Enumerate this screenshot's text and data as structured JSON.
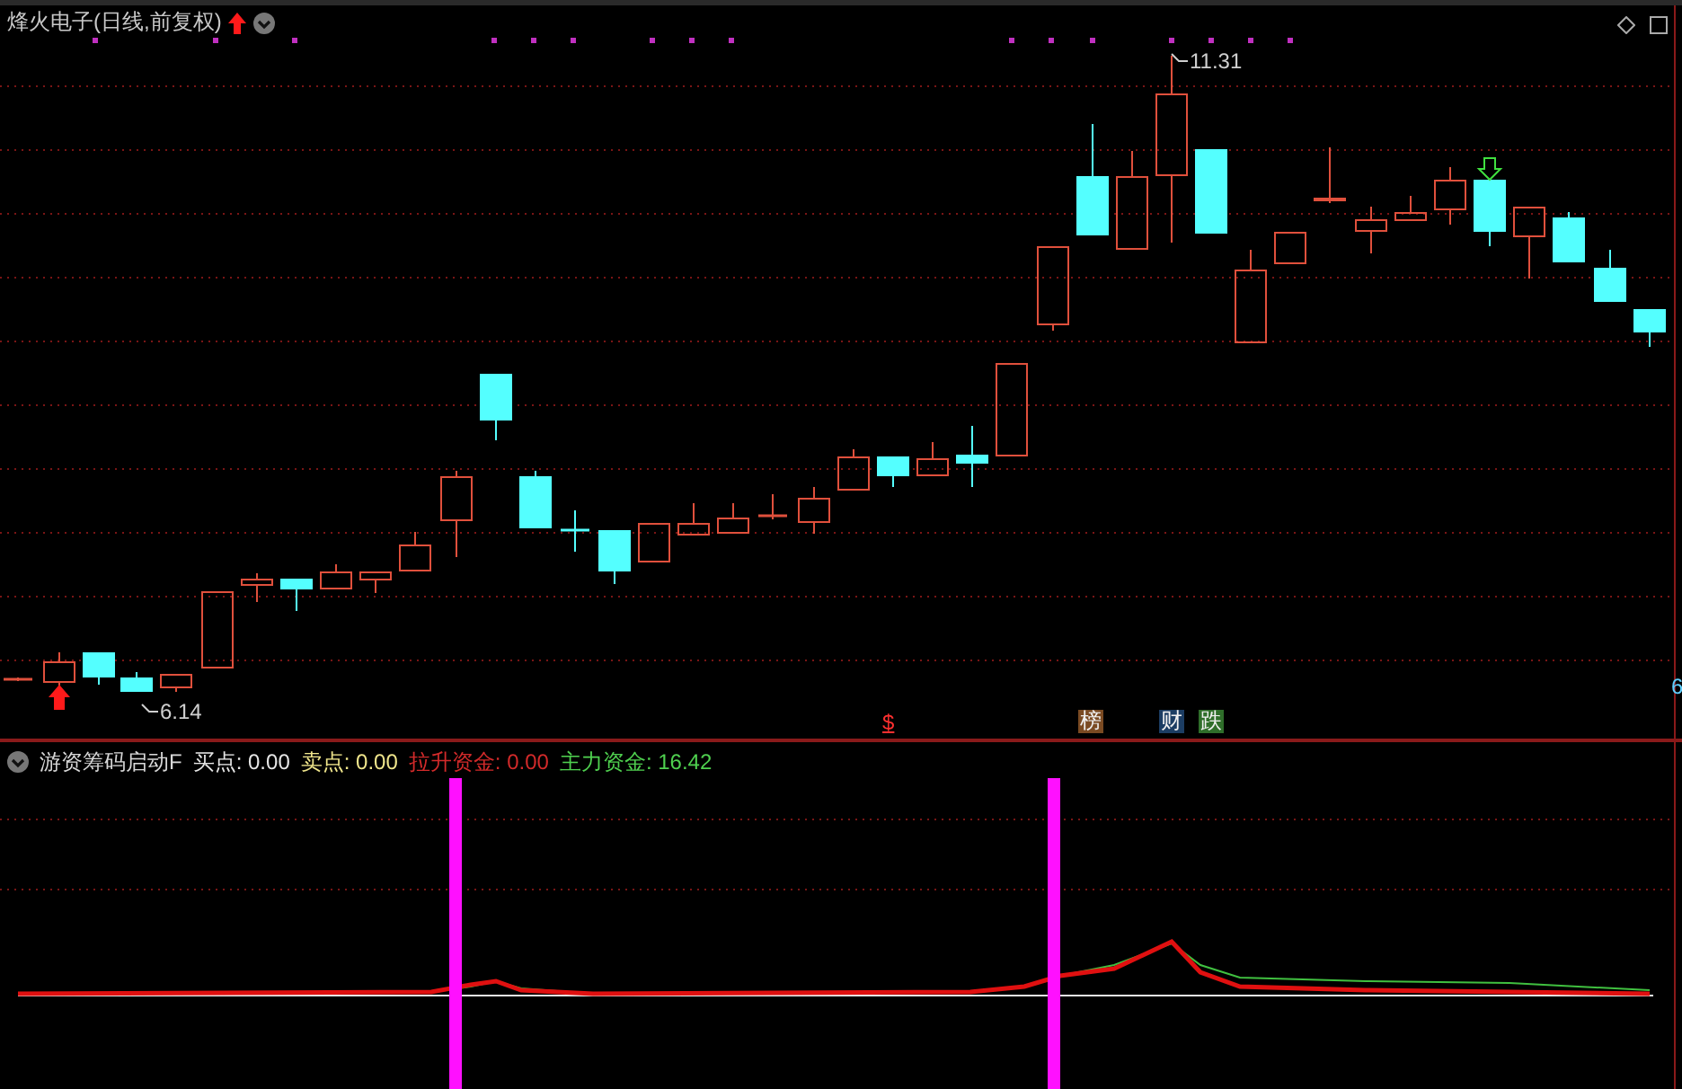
{
  "header": {
    "title": "烽火电子(日线,前复权)"
  },
  "price_labels": [
    {
      "text": "11.31"
    },
    {
      "text": "6.14"
    }
  ],
  "signal_badges": [
    {
      "text": "$",
      "kind": "mark",
      "color": "#ff3030"
    },
    {
      "text": "榜",
      "kind": "tag",
      "color": "#7a4a22"
    },
    {
      "text": "财",
      "kind": "tag",
      "color": "#1c3d63"
    },
    {
      "text": "跌",
      "kind": "tag",
      "color": "#2f6e2a"
    }
  ],
  "axis_label": "6",
  "indicator": {
    "name": "游资筹码启动F",
    "readings": [
      {
        "text": "买点: 0.00",
        "color": "#e6e6e6"
      },
      {
        "text": "卖点: 0.00",
        "color": "#f0e68c"
      },
      {
        "text": "拉升资金: 0.00",
        "color": "#d22a2a"
      },
      {
        "text": "主力资金: 16.42",
        "color": "#4fd04f"
      }
    ]
  }
}
